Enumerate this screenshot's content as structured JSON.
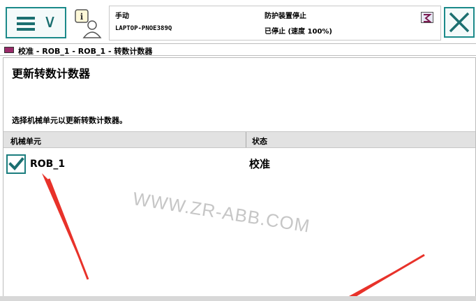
{
  "header": {
    "mode": "手动",
    "host": "LAPTOP-PNOE389Q",
    "state": "防护装置停止",
    "speed": "已停止 (速度 100%)"
  },
  "breadcrumb": "校准 - ROB_1 - ROB_1 - 转数计数器",
  "panel": {
    "title": "更新转数计数器",
    "instruction": "选择机械单元以更新转数计数器。"
  },
  "table": {
    "columns": [
      "机械单元",
      "状态"
    ],
    "rows": [
      {
        "unit": "ROB_1",
        "state": "校准",
        "checked": true
      }
    ]
  },
  "watermark": "WWW.ZR-ABB.COM",
  "icons": {
    "menu": "hamburger-menu-icon",
    "chevron": "chevron-down-icon",
    "info": "info-person-icon",
    "state": "guard-stop-icon",
    "close": "close-icon",
    "app": "calibration-app-icon",
    "check": "checkmark-icon"
  },
  "colors": {
    "accent": "#1b8a8a",
    "header_bg": "#e2e2e2",
    "annotation": "#e8322a"
  }
}
